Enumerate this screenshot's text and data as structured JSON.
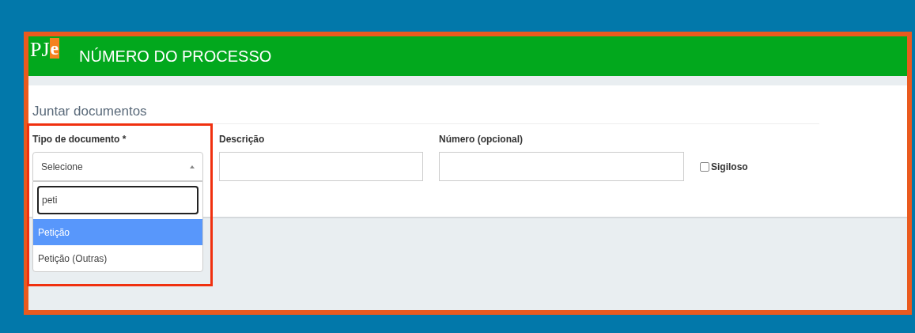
{
  "header": {
    "logo": {
      "letters": "PJ",
      "accent": "e"
    },
    "title": "NÚMERO DO PROCESSO"
  },
  "section_title": "Juntar documentos",
  "fields": [
    {
      "kind": "select",
      "label": "Tipo de documento *",
      "value": "Selecione",
      "expanded": true,
      "highlighted": true,
      "search": "peti",
      "options": [
        {
          "label": "Petição",
          "selected": true
        },
        {
          "label": "Petição (Outras)",
          "selected": false
        }
      ]
    },
    {
      "kind": "text",
      "label": "Descrição"
    },
    {
      "kind": "text",
      "label": "Número (opcional)"
    },
    {
      "kind": "checkbox",
      "label": "Sigiloso",
      "checked": false
    }
  ]
}
